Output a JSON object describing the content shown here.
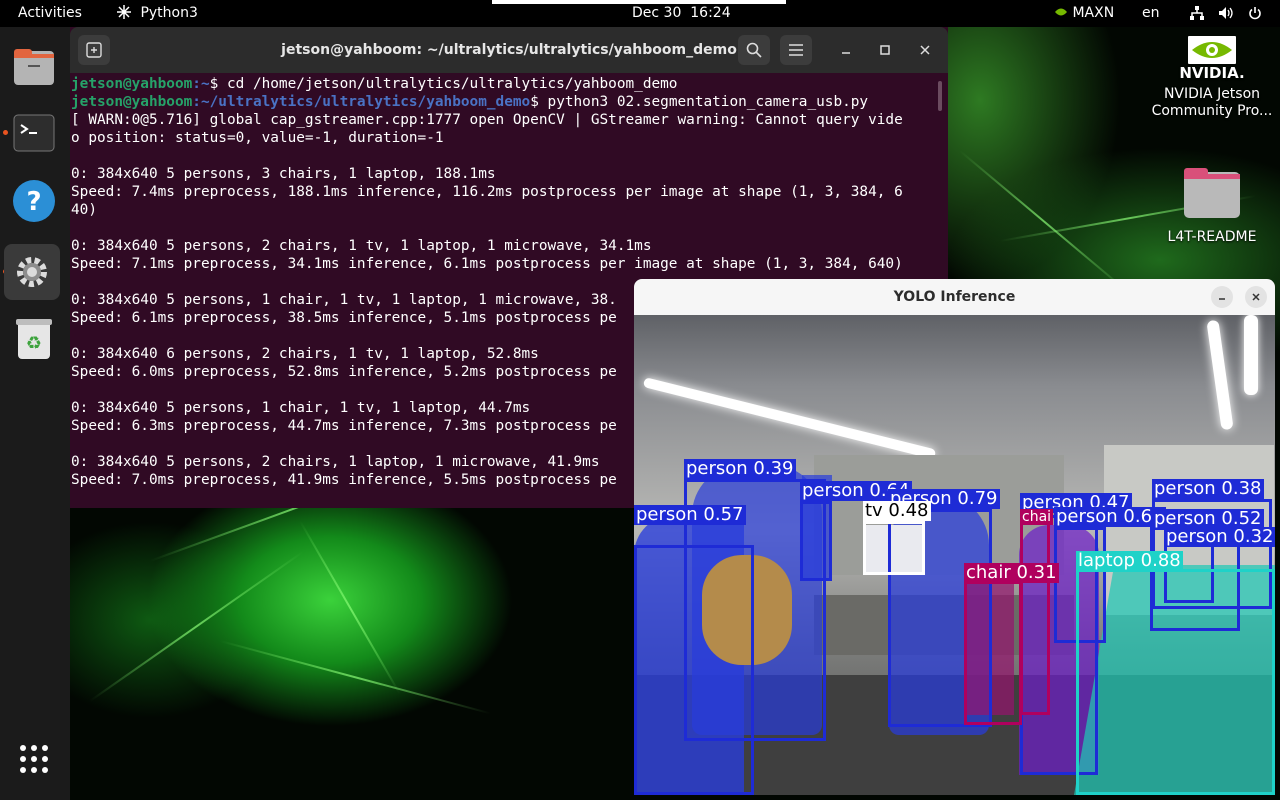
{
  "topbar": {
    "activities": "Activities",
    "app_name": "Python3",
    "clock": "Dec 30  16:24",
    "power_mode": "MAXN",
    "language": "en"
  },
  "desktop": {
    "nvidia_logo_text": "NVIDIA.",
    "nvidia_label_line1": "NVIDIA Jetson",
    "nvidia_label_line2": "Community Pro...",
    "readme_label": "L4T-README"
  },
  "terminal": {
    "title": "jetson@yahboom: ~/ultralytics/ultralytics/yahboom_demo",
    "prompt_user": "jetson@yahboom",
    "line1_path": ":~",
    "line1_cmd": "$ cd /home/jetson/ultralytics/ultralytics/yahboom_demo",
    "line2_path": ":~/ultralytics/ultralytics/yahboom_demo",
    "line2_cmd": "$ python3 02.segmentation_camera_usb.py",
    "output": [
      "[ WARN:0@5.716] global cap_gstreamer.cpp:1777 open OpenCV | GStreamer warning: Cannot query vide",
      "o position: status=0, value=-1, duration=-1",
      "",
      "0: 384x640 5 persons, 3 chairs, 1 laptop, 188.1ms",
      "Speed: 7.4ms preprocess, 188.1ms inference, 116.2ms postprocess per image at shape (1, 3, 384, 6",
      "40)",
      "",
      "0: 384x640 5 persons, 2 chairs, 1 tv, 1 laptop, 1 microwave, 34.1ms",
      "Speed: 7.1ms preprocess, 34.1ms inference, 6.1ms postprocess per image at shape (1, 3, 384, 640)",
      "",
      "0: 384x640 5 persons, 1 chair, 1 tv, 1 laptop, 1 microwave, 38.",
      "Speed: 6.1ms preprocess, 38.5ms inference, 5.1ms postprocess pe",
      "",
      "0: 384x640 6 persons, 2 chairs, 1 tv, 1 laptop, 52.8ms",
      "Speed: 6.0ms preprocess, 52.8ms inference, 5.2ms postprocess pe",
      "",
      "0: 384x640 5 persons, 1 chair, 1 tv, 1 laptop, 44.7ms",
      "Speed: 6.3ms preprocess, 44.7ms inference, 7.3ms postprocess pe",
      "",
      "0: 384x640 5 persons, 2 chairs, 1 laptop, 1 microwave, 41.9ms",
      "Speed: 7.0ms preprocess, 41.9ms inference, 5.5ms postprocess pe"
    ]
  },
  "yolo_window": {
    "title": "YOLO Inference",
    "detections": [
      {
        "label": "person 0.39",
        "color": "#1e2bd6"
      },
      {
        "label": "person 0.64",
        "color": "#1e2bd6"
      },
      {
        "label": "person 0.79",
        "color": "#1e2bd6"
      },
      {
        "label": "person 0.57",
        "color": "#1e2bd6"
      },
      {
        "label": "tv 0.48",
        "color": "#ffffff"
      },
      {
        "label": "person 0.47",
        "color": "#1e2bd6"
      },
      {
        "label": "chai",
        "color": "#b0005e"
      },
      {
        "label": "person 0.66",
        "color": "#1e2bd6"
      },
      {
        "label": "person 0.38",
        "color": "#1e2bd6"
      },
      {
        "label": "person 0.52",
        "color": "#1e2bd6"
      },
      {
        "label": "person 0.32",
        "color": "#1e2bd6"
      },
      {
        "label": "chair 0.31",
        "color": "#b0005e"
      },
      {
        "label": "laptop 0.88",
        "color": "#1fd2c8"
      }
    ]
  },
  "colors": {
    "terminal_bg": "#300a24",
    "prompt_green": "#26a269",
    "prompt_blue": "#4a72c4",
    "ubuntu_orange": "#e95420",
    "person_box": "#1e2bd6",
    "laptop_box": "#1fd2c8",
    "chair_box": "#b0005e"
  },
  "icons": [
    "grid-icon",
    "network-icon",
    "volume-icon",
    "power-icon",
    "files-icon",
    "terminal-icon",
    "help-icon",
    "settings-icon",
    "trash-icon",
    "show-apps-icon",
    "search-icon",
    "menu-icon",
    "minimize-icon",
    "maximize-icon",
    "close-icon"
  ]
}
